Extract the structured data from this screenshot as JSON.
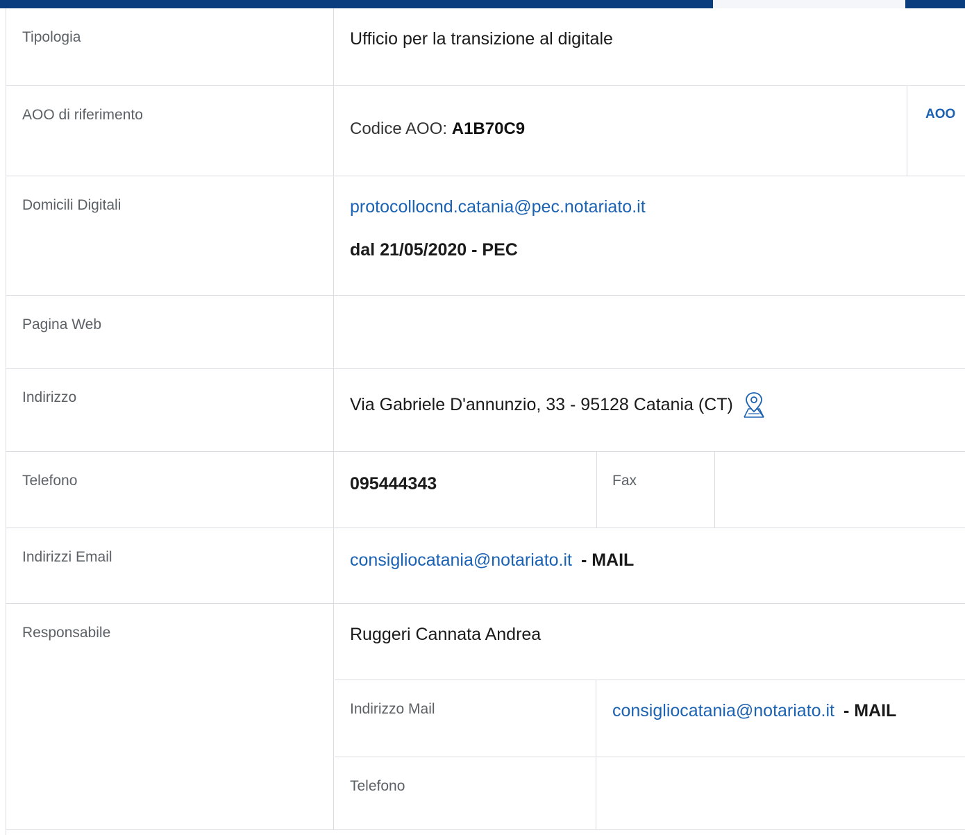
{
  "tipologia": {
    "label": "Tipologia",
    "value": "Ufficio per la transizione al digitale"
  },
  "aoo": {
    "label": "AOO di riferimento",
    "code_prefix": "Codice AOO: ",
    "code": "A1B70C9",
    "link": "AOO"
  },
  "domicili": {
    "label": "Domicili Digitali",
    "pec": "protocollocnd.catania@pec.notariato.it",
    "since": "dal 21/05/2020 - PEC"
  },
  "pagina_web": {
    "label": "Pagina Web",
    "value": ""
  },
  "indirizzo": {
    "label": "Indirizzo",
    "value": "Via Gabriele D'annunzio, 33 - 95128 Catania (CT)",
    "icon": "map-pin-icon"
  },
  "telefono": {
    "label": "Telefono",
    "value": "095444343",
    "fax_label": "Fax",
    "fax_value": ""
  },
  "email": {
    "label": "Indirizzi Email",
    "address": "consigliocatania@notariato.it",
    "type": " - MAIL"
  },
  "responsabile": {
    "label": "Responsabile",
    "name": "Ruggeri Cannata Andrea",
    "mail_label": "Indirizzo Mail",
    "mail_address": "consigliocatania@notariato.it",
    "mail_type": " - MAIL",
    "phone_label": "Telefono",
    "phone_value": ""
  },
  "colors": {
    "navy": "#0a3d7e",
    "link": "#1b62b3",
    "border": "#d9dde1"
  }
}
